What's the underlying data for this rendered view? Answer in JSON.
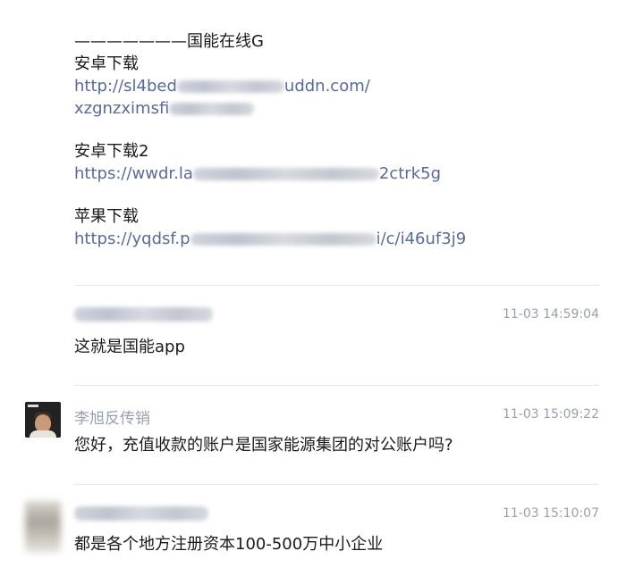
{
  "post": {
    "title_line": "———————国能在线G",
    "android_label": "安卓下载",
    "android_link_part1_start": "http://sl4bed",
    "android_link_part1_end": "uddn.com/",
    "android_link_part2_start": "xzgnzximsfi",
    "android2_label": "安卓下载2",
    "android2_link_start": "https://wwdr.la",
    "android2_link_end": "2ctrk5g",
    "apple_label": "苹果下载",
    "apple_link_start": "https://yqdsf.p",
    "apple_link_end": "i/c/i46uf3j9"
  },
  "comments": [
    {
      "nickname": "",
      "time": "11-03 14:59:04",
      "text": "这就是国能app"
    },
    {
      "nickname": "李旭反传销",
      "time": "11-03 15:09:22",
      "text": "您好，充值收款的账户是国家能源集团的对公账户吗?"
    },
    {
      "nickname": "",
      "time": "11-03 15:10:07",
      "text": "都是各个地方注册资本100-500万中小企业"
    }
  ],
  "colors": {
    "link": "#576b95",
    "meta": "#9aa0aa",
    "text": "#1a1a1a",
    "divider": "#e6e6e6"
  }
}
